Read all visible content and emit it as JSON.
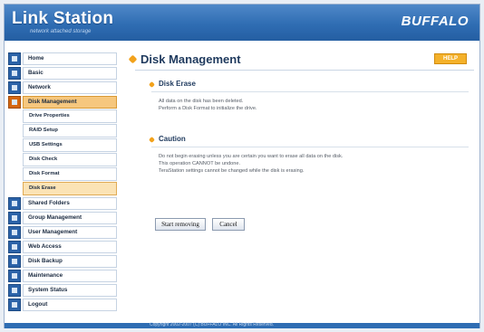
{
  "header": {
    "logo": "Link Station",
    "tagline": "network attached storage",
    "brand": "BUFFALO"
  },
  "sidebar": {
    "items": [
      {
        "label": "Home"
      },
      {
        "label": "Basic"
      },
      {
        "label": "Network"
      },
      {
        "label": "Disk Management"
      },
      {
        "label": "Shared Folders"
      },
      {
        "label": "Group Management"
      },
      {
        "label": "User Management"
      },
      {
        "label": "Web Access"
      },
      {
        "label": "Disk Backup"
      },
      {
        "label": "Maintenance"
      },
      {
        "label": "System Status"
      },
      {
        "label": "Logout"
      }
    ],
    "subitems": [
      {
        "label": "Drive Properties"
      },
      {
        "label": "RAID Setup"
      },
      {
        "label": "USB Settings"
      },
      {
        "label": "Disk Check"
      },
      {
        "label": "Disk Format"
      },
      {
        "label": "Disk Erase"
      }
    ]
  },
  "main": {
    "title": "Disk Management",
    "help_label": "HELP",
    "erase_section": {
      "title": "Disk Erase",
      "line1": "All data on the disk has been deleted.",
      "line2": "Perform a Disk Format to initialize the drive."
    },
    "caution_section": {
      "title": "Caution",
      "line1": "Do not begin erasing unless you are certain you want to erase all data on the disk.",
      "line2": "This operation CANNOT be undone.",
      "line3": "TeraStation settings cannot be changed while the disk is erasing."
    },
    "start_button": "Start removing",
    "cancel_button": "Cancel"
  },
  "footer": {
    "copyright": "Copyright 2002-2007 (C) BUFFALO INC. All Rights Reserved."
  }
}
